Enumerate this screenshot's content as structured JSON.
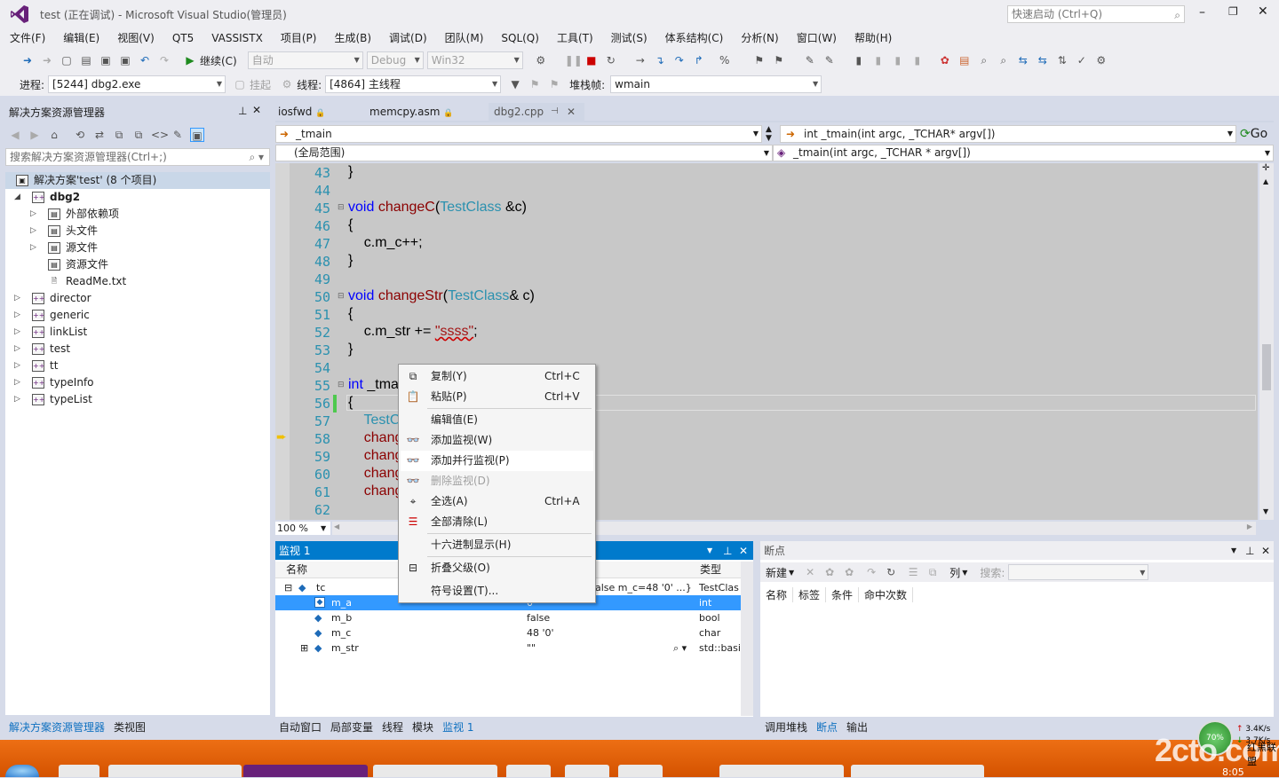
{
  "window": {
    "title": "test (正在调试) - Microsoft Visual Studio(管理员)",
    "quick_launch": "快速启动 (Ctrl+Q)"
  },
  "menu": [
    "文件(F)",
    "编辑(E)",
    "视图(V)",
    "QT5",
    "VASSISTX",
    "项目(P)",
    "生成(B)",
    "调试(D)",
    "团队(M)",
    "SQL(Q)",
    "工具(T)",
    "测试(S)",
    "体系结构(C)",
    "分析(N)",
    "窗口(W)",
    "帮助(H)"
  ],
  "toolbar": {
    "continue_label": "继续(C)",
    "config_auto": "自动",
    "config_debug": "Debug",
    "platform": "Win32"
  },
  "debugbar": {
    "process_label": "进程:",
    "process_value": "[5244] dbg2.exe",
    "suspend_label": "挂起",
    "thread_label": "线程:",
    "thread_value": "[4864] 主线程",
    "stack_label": "堆栈帧:",
    "stack_value": "wmain"
  },
  "solution": {
    "title": "解决方案资源管理器",
    "search_placeholder": "搜索解决方案资源管理器(Ctrl+;)",
    "root": "解决方案'test' (8 个项目)",
    "project": "dbg2",
    "children": [
      "外部依赖项",
      "头文件",
      "源文件",
      "资源文件",
      "ReadMe.txt"
    ],
    "projects": [
      "director",
      "generic",
      "linkList",
      "test",
      "tt",
      "typeInfo",
      "typeList"
    ]
  },
  "left_tabs": [
    "解决方案资源管理器",
    "类视图"
  ],
  "editor": {
    "tabs": [
      "iosfwd",
      "memcpy.asm",
      "dbg2.cpp"
    ],
    "nav_left": "_tmain",
    "nav_right": "int _tmain(int argc, _TCHAR* argv[])",
    "scope_left": "(全局范围)",
    "scope_right": "_tmain(int argc, _TCHAR * argv[])",
    "go": "Go",
    "zoom": "100 %",
    "line_numbers": [
      "43",
      "44",
      "45",
      "46",
      "47",
      "48",
      "49",
      "50",
      "51",
      "52",
      "53",
      "54",
      "55",
      "56",
      "57",
      "58",
      "59",
      "60",
      "61",
      "62"
    ]
  },
  "context_menu": [
    {
      "label": "复制(Y)",
      "shortcut": "Ctrl+C",
      "icon": "copy-icon"
    },
    {
      "label": "粘贴(P)",
      "shortcut": "Ctrl+V",
      "icon": "paste-icon"
    },
    {
      "label": "编辑值(E)",
      "shortcut": "",
      "icon": ""
    },
    {
      "label": "添加监视(W)",
      "shortcut": "",
      "icon": "watch-icon"
    },
    {
      "label": "添加并行监视(P)",
      "shortcut": "",
      "icon": "parallel-watch-icon"
    },
    {
      "label": "删除监视(D)",
      "shortcut": "",
      "icon": "delete-watch-icon"
    },
    {
      "label": "全选(A)",
      "shortcut": "Ctrl+A",
      "icon": "select-all-icon"
    },
    {
      "label": "全部清除(L)",
      "shortcut": "",
      "icon": "clear-all-icon"
    },
    {
      "label": "十六进制显示(H)",
      "shortcut": "",
      "icon": ""
    },
    {
      "label": "折叠父级(O)",
      "shortcut": "",
      "icon": "collapse-parent-icon"
    },
    {
      "label": "符号设置(T)...",
      "shortcut": "",
      "icon": ""
    }
  ],
  "watch": {
    "title": "监视 1",
    "col_name": "名称",
    "col_type": "类型",
    "rows": [
      {
        "name": "tc",
        "value": "alse m_c=48 '0' ...}",
        "type": "TestClas"
      },
      {
        "name": "m_a",
        "value": "0",
        "type": "int"
      },
      {
        "name": "m_b",
        "value": "false",
        "type": "bool"
      },
      {
        "name": "m_c",
        "value": "48 '0'",
        "type": "char"
      },
      {
        "name": "m_str",
        "value": "\"\"",
        "type": "std::basi"
      }
    ]
  },
  "bottom_tabs_left": [
    "自动窗口",
    "局部变量",
    "线程",
    "模块",
    "监视 1"
  ],
  "breakpoints": {
    "title": "断点",
    "new_label": "新建",
    "columns_label": "列",
    "search_label": "搜索:",
    "cols": [
      "名称",
      "标签",
      "条件",
      "命中次数"
    ]
  },
  "bottom_tabs_right": [
    "调用堆栈",
    "断点",
    "输出"
  ],
  "tray": {
    "percent": "70%",
    "up": "3.4K/s",
    "down": "3.7K/s",
    "time": "8:05"
  },
  "watermark": "2cto.com",
  "watermark_sub": "红黑联盟"
}
